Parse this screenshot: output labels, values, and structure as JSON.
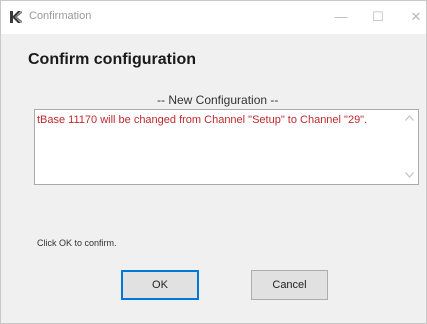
{
  "window": {
    "title": "Confirmation",
    "minimize_glyph": "—",
    "maximize_glyph": "☐",
    "close_glyph": "✕"
  },
  "dialog": {
    "heading": "Confirm configuration",
    "section_label": "-- New Configuration --",
    "message": "tBase 11170 will be changed from Channel \"Setup\" to Channel \"29\".",
    "hint": "Click OK to confirm.",
    "ok_label": "OK",
    "cancel_label": "Cancel"
  },
  "icons": {
    "app": "app-logo-icon",
    "scroll_up": "scroll-up-arrow-icon",
    "scroll_down": "scroll-down-arrow-icon"
  },
  "colors": {
    "message_text": "#c0282d",
    "focus_border": "#0078d7",
    "dialog_background": "#f0f0f0"
  }
}
